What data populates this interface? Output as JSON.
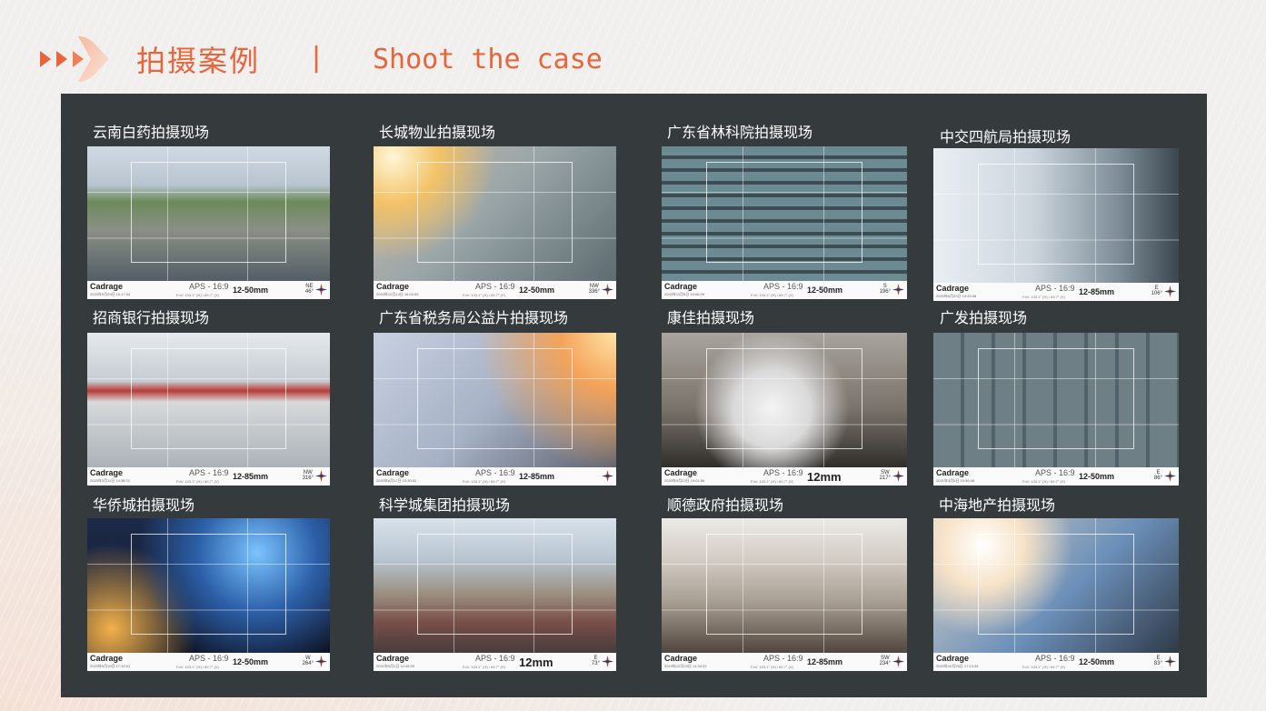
{
  "header": {
    "title_cn": "拍摄案例",
    "divider": "|",
    "title_en": "Shoot the case",
    "accent_color": "#e8643a",
    "logo_icon": "play-arrows-logo-icon"
  },
  "cases": [
    {
      "label": "云南白药拍摄现场",
      "brand": "Cadrage",
      "stamp": "2020年9月29日 10:17:04",
      "aps": "APS - 16:9",
      "fov": "FoV: 103.1° (H) / 69.7° (V)",
      "lens": "12-50mm",
      "dir": "NE",
      "deg": "46°",
      "scene": "outdoor"
    },
    {
      "label": "长城物业拍摄现场",
      "brand": "Cadrage",
      "stamp": "2020年12月14日 16:02:05",
      "aps": "APS - 16:9",
      "fov": "FoV: 103.1° (H) / 69.7° (V)",
      "lens": "12-50mm",
      "dir": "NW",
      "deg": "336°",
      "scene": "office-warm"
    },
    {
      "label": "广东省林科院拍摄现场",
      "brand": "Cadrage",
      "stamp": "2020年11月5日 15:06:09",
      "aps": "APS - 16:9",
      "fov": "FoV: 103.1° (H) / 69.7° (V)",
      "lens": "12-50mm",
      "dir": "S",
      "deg": "196°",
      "scene": "lab"
    },
    {
      "label": "中交四航局拍摄现场",
      "brand": "Cadrage",
      "stamp": "2020年6月23日 13:43:48",
      "aps": "APS - 16:9",
      "fov": "FoV: 103.1° (H) / 69.7° (V)",
      "lens": "12-85mm",
      "dir": "E",
      "deg": "106°",
      "scene": "studio-white"
    },
    {
      "label": "招商银行拍摄现场",
      "brand": "Cadrage",
      "stamp": "2020年3月11日 14:38:21",
      "aps": "APS - 16:9",
      "fov": "FoV: 103.1° (H) / 69.7° (V)",
      "lens": "12-85mm",
      "dir": "NW",
      "deg": "316°",
      "scene": "bank"
    },
    {
      "label": "广东省税务局公益片拍摄现场",
      "brand": "Cadrage",
      "stamp": "2020年6月17日 13:30:02",
      "aps": "APS - 16:9",
      "fov": "FoV: 103.1° (H) / 69.7° (V)",
      "lens": "12-85mm",
      "dir": "",
      "deg": "",
      "scene": "hospital"
    },
    {
      "label": "康佳拍摄现场",
      "brand": "Cadrage",
      "stamp": "2020年9月23日 19:01:56",
      "aps": "APS - 16:9",
      "fov": "FoV: 103.1° (H) / 69.7° (V)",
      "lens": "12mm",
      "dir": "SW",
      "deg": "217°",
      "scene": "college",
      "lens_big": true
    },
    {
      "label": "广发拍摄现场",
      "brand": "Cadrage",
      "stamp": "2021年3月5日 15:56:48",
      "aps": "APS - 16:9",
      "fov": "FoV: 103.1° (H) / 69.7° (V)",
      "lens": "12-50mm",
      "dir": "E",
      "deg": "86°",
      "scene": "glass-office"
    },
    {
      "label": "华侨城拍摄现场",
      "brand": "Cadrage",
      "stamp": "2020年9月10日 17:32:01",
      "aps": "APS - 16:9",
      "fov": "FoV: 103.1° (H) / 69.7° (V)",
      "lens": "12-50mm",
      "dir": "W",
      "deg": "264°",
      "scene": "stage"
    },
    {
      "label": "科学城集团拍摄现场",
      "brand": "Cadrage",
      "stamp": "2021年6月1日 10:45:03",
      "aps": "APS - 16:9",
      "fov": "FoV: 103.1° (H) / 69.7° (V)",
      "lens": "12mm",
      "dir": "E",
      "deg": "73°",
      "scene": "construction",
      "lens_big": true
    },
    {
      "label": "顺德政府拍摄现场",
      "brand": "Cadrage",
      "stamp": "2019年12月23日 14:34:33",
      "aps": "APS - 16:9",
      "fov": "FoV: 103.1° (H) / 69.7° (V)",
      "lens": "12-85mm",
      "dir": "SW",
      "deg": "234°",
      "scene": "meeting"
    },
    {
      "label": "中海地产拍摄现场",
      "brand": "Cadrage",
      "stamp": "2020年10月26日 17:13:45",
      "aps": "APS - 16:9",
      "fov": "FoV: 103.1° (H) / 69.7° (V)",
      "lens": "12-50mm",
      "dir": "E",
      "deg": "83°",
      "scene": "live-studio"
    }
  ]
}
